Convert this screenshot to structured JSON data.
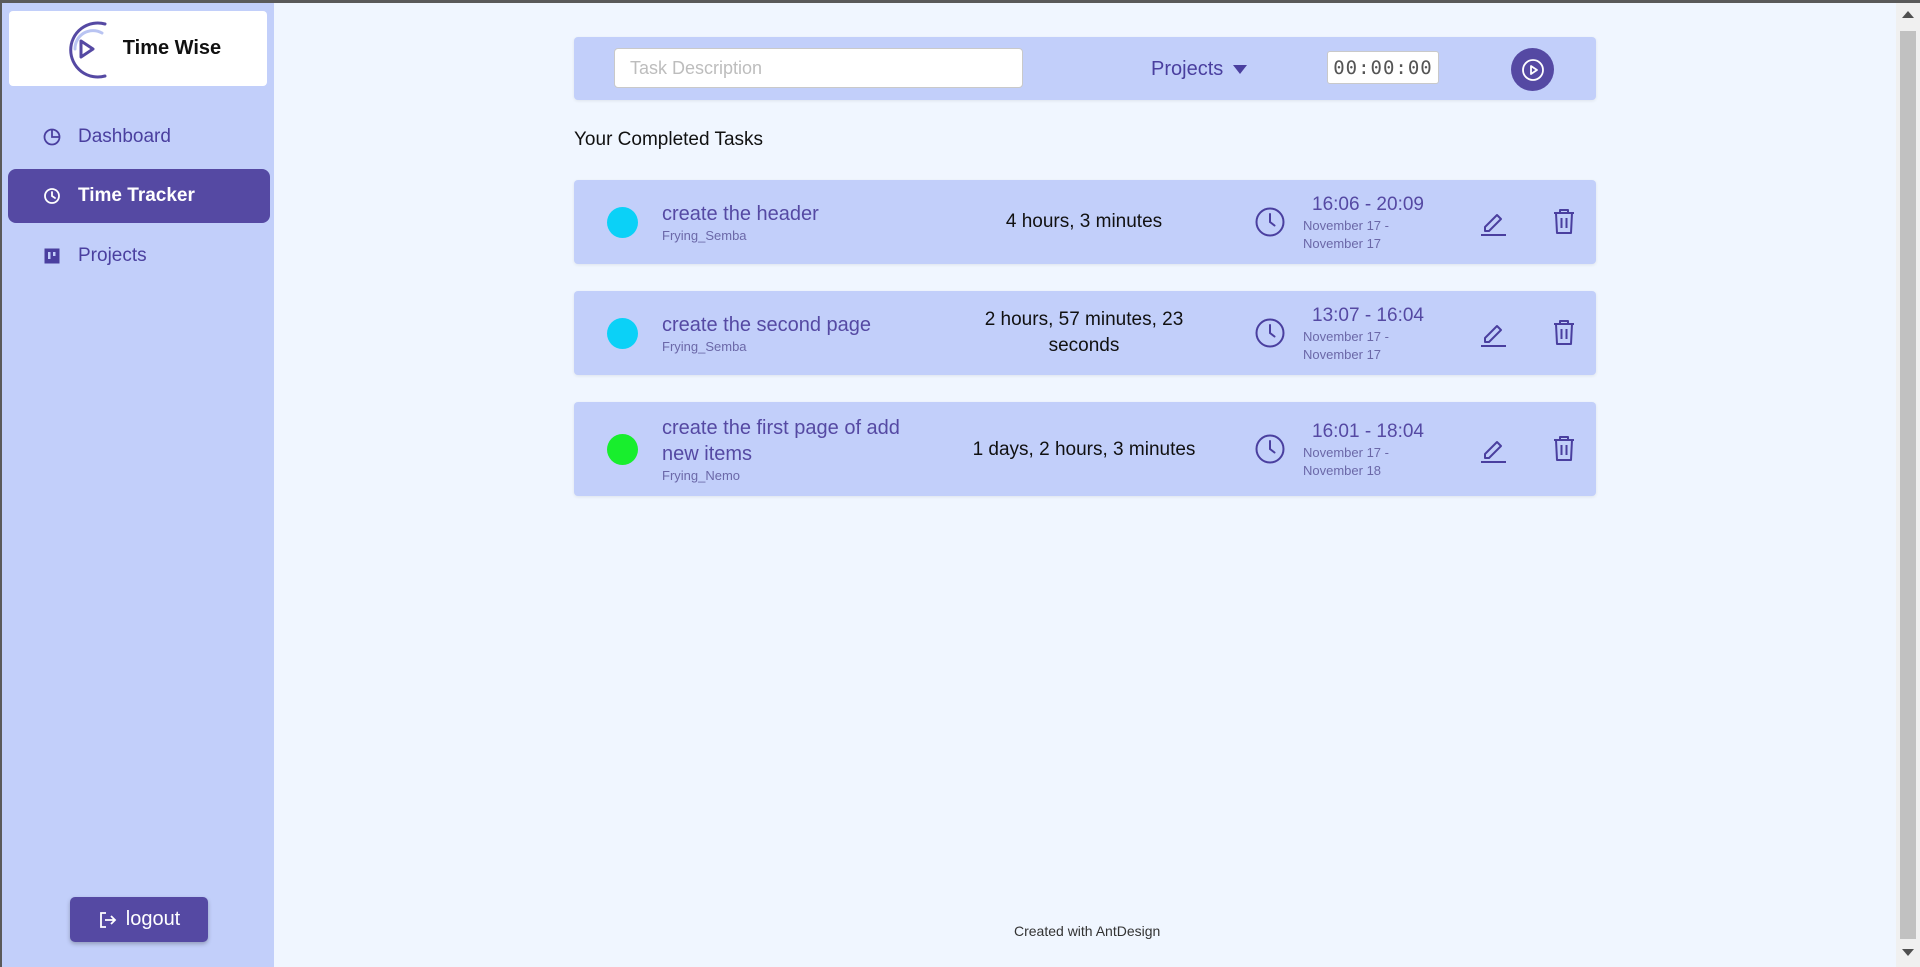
{
  "app": {
    "name": "Time Wise"
  },
  "sidebar": {
    "items": [
      {
        "label": "Dashboard",
        "icon": "pie-chart-icon",
        "active": false
      },
      {
        "label": "Time Tracker",
        "icon": "clock-icon",
        "active": true
      },
      {
        "label": "Projects",
        "icon": "project-board-icon",
        "active": false
      }
    ],
    "logout_label": "logout"
  },
  "entry": {
    "placeholder": "Task Description",
    "projects_label": "Projects",
    "timer": "00:00:00"
  },
  "tasks_title": "Your Completed Tasks",
  "tasks": [
    {
      "name": "create the header",
      "project": "Frying_Semba",
      "color": "#0bd1f7",
      "duration": "4 hours, 3 minutes",
      "time_range": "16:06 - 20:09",
      "date_range": "November 17 - November 17"
    },
    {
      "name": "create the second page",
      "project": "Frying_Semba",
      "color": "#0bd1f7",
      "duration": "2 hours, 57 minutes, 23 seconds",
      "time_range": "13:07 - 16:04",
      "date_range": "November 17 - November 17"
    },
    {
      "name": "create the first page of add new items",
      "project": "Frying_Nemo",
      "color": "#18ee2d",
      "duration": "1 days, 2 hours, 3 minutes",
      "time_range": "16:01 - 18:04",
      "date_range": "November 17 - November 18"
    }
  ],
  "footer": "Created with AntDesign",
  "colors": {
    "primary": "#5549a3",
    "sidebar_bg": "#c2cffa",
    "page_bg": "#f0f6ff"
  }
}
